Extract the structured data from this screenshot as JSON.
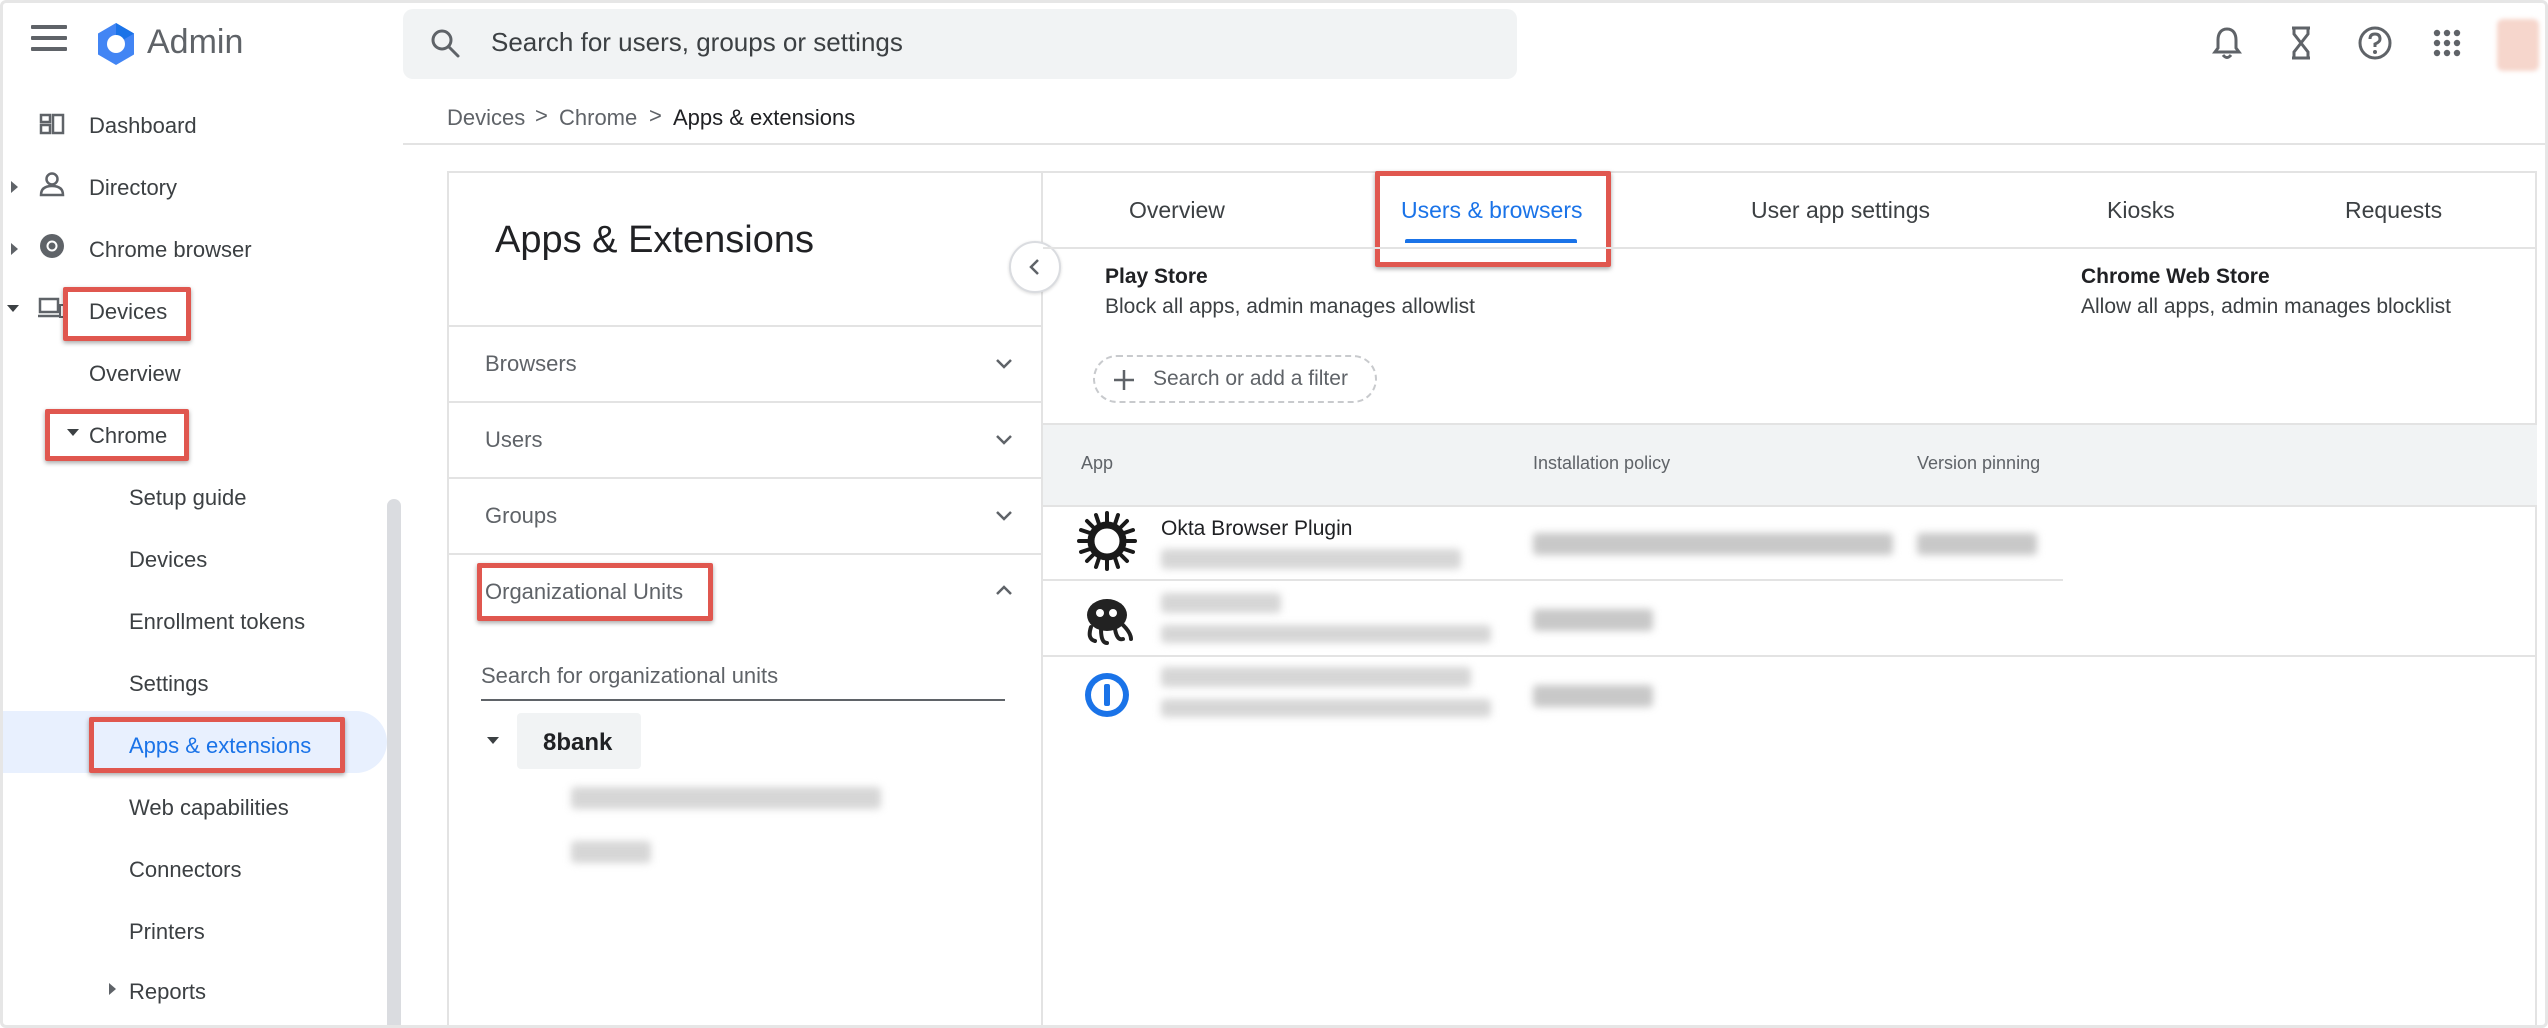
{
  "header": {
    "app_title": "Admin",
    "search_placeholder": "Search for users, groups or settings",
    "icons": [
      "menu-icon",
      "google-admin-logo",
      "search-icon",
      "notifications-icon",
      "tasks-hourglass-icon",
      "help-icon",
      "apps-grid-icon",
      "account-avatar"
    ]
  },
  "sidebar": {
    "dashboard": "Dashboard",
    "directory": "Directory",
    "chrome_browser": "Chrome browser",
    "devices": "Devices",
    "overview": "Overview",
    "chrome": "Chrome",
    "setup_guide": "Setup guide",
    "devices_sub": "Devices",
    "enrollment_tokens": "Enrollment tokens",
    "settings": "Settings",
    "apps_extensions": "Apps & extensions",
    "web_capabilities": "Web capabilities",
    "connectors": "Connectors",
    "printers": "Printers",
    "reports": "Reports"
  },
  "breadcrumb": {
    "item1": "Devices",
    "item2": "Chrome",
    "item3": "Apps & extensions",
    "separator": ">"
  },
  "side_panel": {
    "title": "Apps & Extensions",
    "browsers": "Browsers",
    "users": "Users",
    "groups": "Groups",
    "org_units": "Organizational Units",
    "ou_search_placeholder": "Search for organizational units",
    "ou_root": "8bank"
  },
  "tabs": {
    "overview": "Overview",
    "users_browsers": "Users & browsers",
    "user_app_settings": "User app settings",
    "kiosks": "Kiosks",
    "requests": "Requests"
  },
  "stores": {
    "play_title": "Play Store",
    "play_policy": "Block all apps, admin manages allowlist",
    "web_title": "Chrome Web Store",
    "web_policy": "Allow all apps, admin manages blocklist"
  },
  "filter": {
    "label": "Search or add a filter"
  },
  "table": {
    "col_app": "App",
    "col_install": "Installation policy",
    "col_version": "Version pinning",
    "rows": [
      {
        "name": "Okta Browser Plugin",
        "icon": "okta-icon"
      },
      {
        "name": "",
        "icon": "octopus-extension-icon"
      },
      {
        "name": "",
        "icon": "1password-icon"
      }
    ]
  },
  "colors": {
    "accent_blue": "#1a73e8",
    "highlight_red": "#e0574f",
    "active_bg": "#e8f0fe"
  }
}
